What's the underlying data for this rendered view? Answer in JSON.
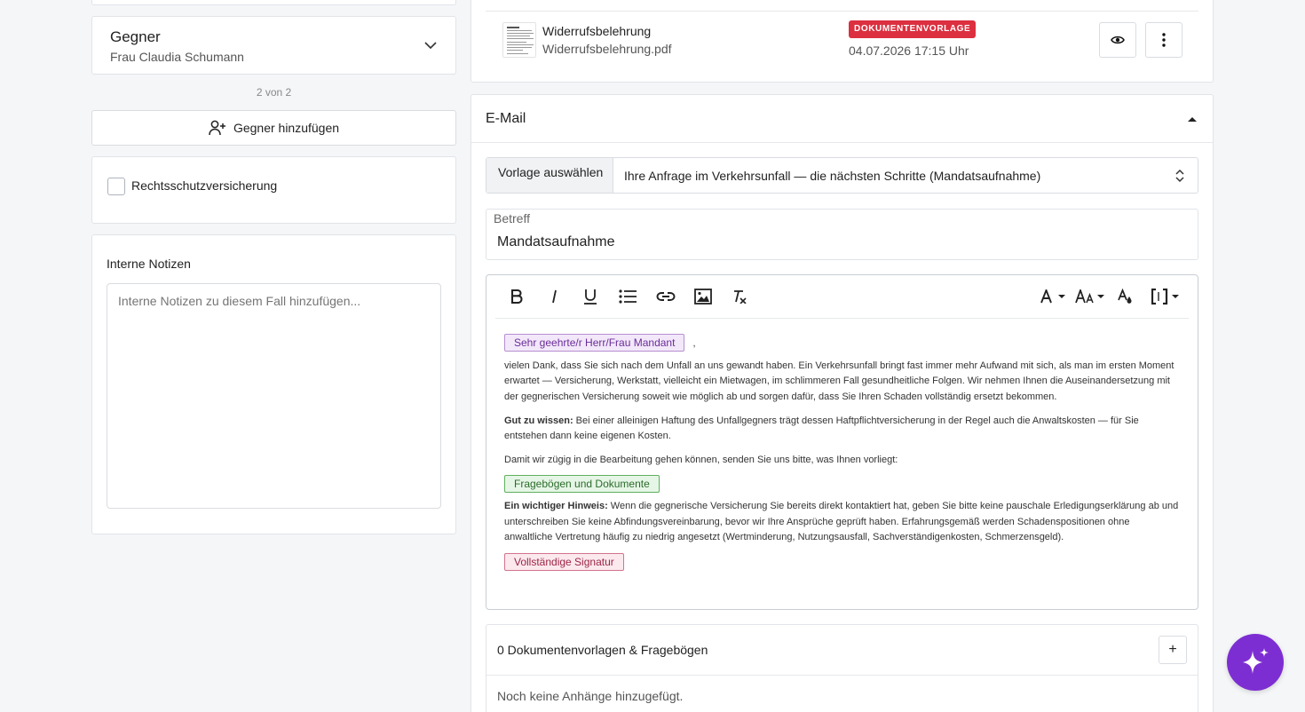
{
  "opponent": {
    "title": "Gegner",
    "name": "Frau Claudia Schumann",
    "counter": "2 von 2",
    "add_label": "Gegner hinzufügen"
  },
  "insurance": {
    "label": "Rechtsschutzversicherung",
    "checked": false
  },
  "notes": {
    "title": "Interne Notizen",
    "placeholder": "Interne Notizen zu diesem Fall hinzufügen..."
  },
  "document": {
    "name": "Widerrufsbelehrung",
    "file": "Widerrufsbelehrung.pdf",
    "badge": "DOKUMENTENVORLAGE",
    "date": "04.07.2026 17:15 Uhr"
  },
  "email": {
    "title": "E-Mail",
    "template_label": "Vorlage auswählen",
    "template_value": "Ihre Anfrage im Verkehrsunfall — die nächsten Schritte (Mandatsaufnahme)",
    "subject_label": "Betreff",
    "subject_value": "Mandatsaufnahme",
    "body": {
      "greeting_chip": "Sehr geehrte/r Herr/Frau Mandant",
      "greeting_comma": ",",
      "p1": "vielen Dank, dass Sie sich nach dem Unfall an uns gewandt haben. Ein Verkehrsunfall bringt fast immer mehr Aufwand mit sich, als man im ersten Moment erwartet — Versicherung, Werkstatt, vielleicht ein Mietwagen, im schlimmeren Fall gesundheitliche Folgen. Wir nehmen Ihnen die Auseinandersetzung mit der gegnerischen Versicherung soweit wie möglich ab und sorgen dafür, dass Sie Ihren Schaden vollständig ersetzt bekommen.",
      "p2_bold": "Gut zu wissen:",
      "p2": " Bei einer alleinigen Haftung des Unfallgegners trägt dessen Haftpflichtversicherung in der Regel auch die Anwaltskosten — für Sie entstehen dann keine eigenen Kosten.",
      "p3": "Damit wir zügig in die Bearbeitung gehen können, senden Sie uns bitte, was Ihnen vorliegt:",
      "docs_chip": "Fragebögen und Dokumente",
      "p4_bold": "Ein wichtiger Hinweis:",
      "p4": " Wenn die gegnerische Versicherung Sie bereits direkt kontaktiert hat, geben Sie bitte keine pauschale Erledigungserklärung ab und unterschreiben Sie keine Abfindungsvereinbarung, bevor wir Ihre Ansprüche geprüft haben. Erfahrungsgemäß werden Schadenspositionen ohne anwaltliche Vertretung häufig zu niedrig angesetzt (Wertminderung, Nutzungsausfall, Sachverständigenkosten, Schmerzensgeld).",
      "signature_chip": "Vollständige Signatur"
    },
    "attachments_title": "0 Dokumentenvorlagen & Fragebögen",
    "add_attachment": "+",
    "attachments_empty": "Noch keine Anhänge hinzugefügt."
  },
  "colors": {
    "accent_purple": "#7d2ed2",
    "badge_red": "#dc2f3f"
  }
}
